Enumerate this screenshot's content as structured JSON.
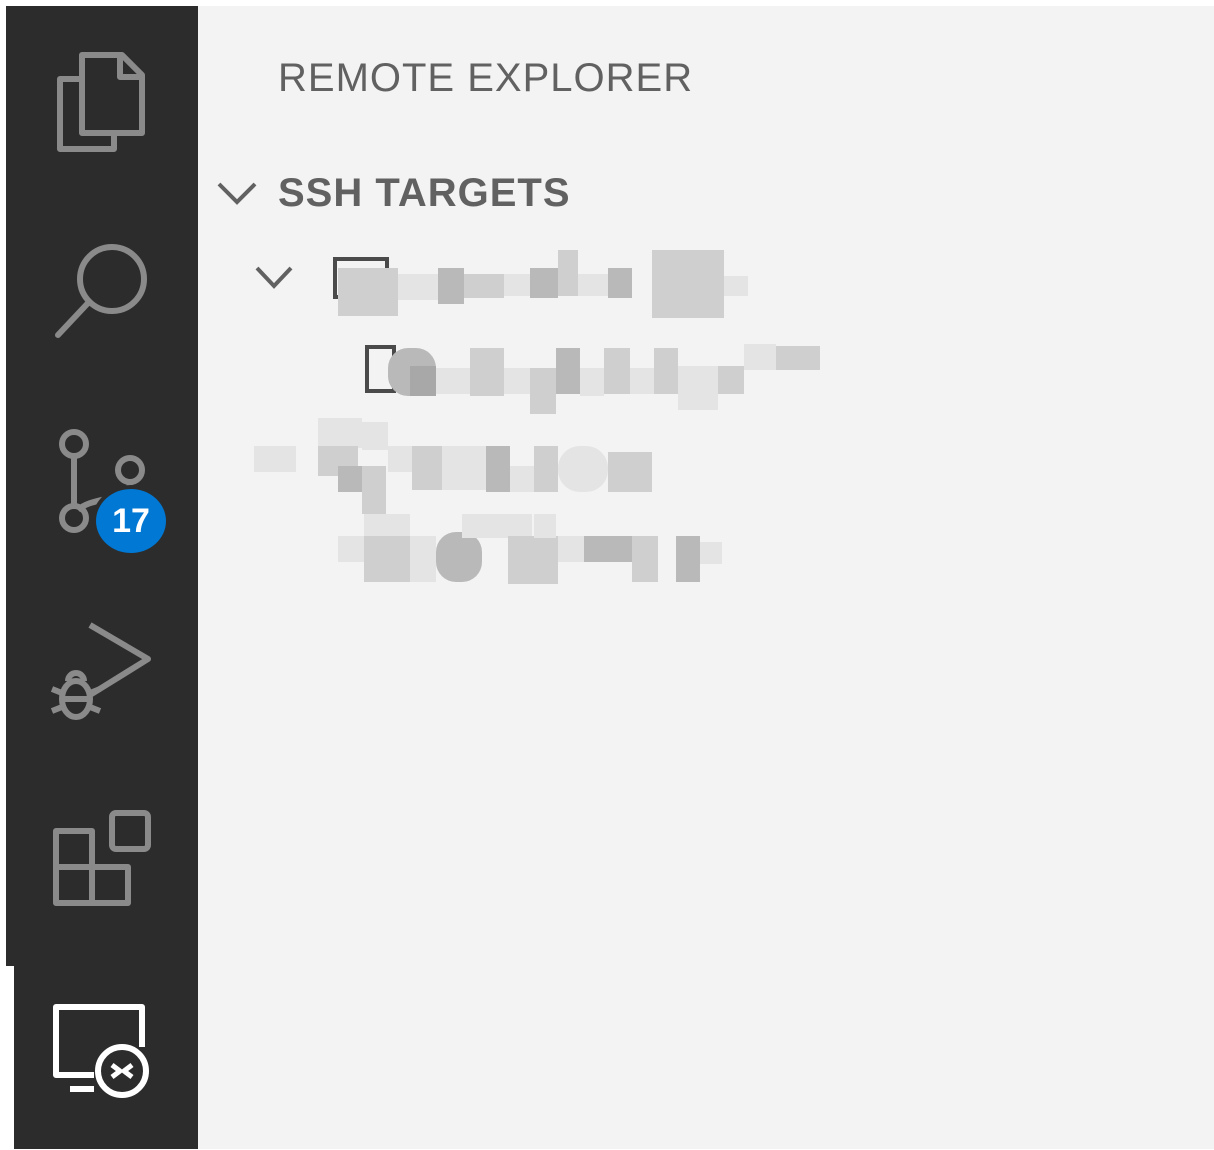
{
  "activity_bar": {
    "items": [
      {
        "name": "explorer",
        "icon": "files-icon"
      },
      {
        "name": "search",
        "icon": "search-icon"
      },
      {
        "name": "source-control",
        "icon": "source-control-icon",
        "badge": "17"
      },
      {
        "name": "run-and-debug",
        "icon": "run-debug-icon"
      },
      {
        "name": "extensions",
        "icon": "extensions-icon"
      },
      {
        "name": "remote-explorer",
        "icon": "remote-explorer-icon",
        "active": true
      }
    ]
  },
  "sidebar": {
    "title": "REMOTE EXPLORER",
    "section": {
      "title": "SSH TARGETS",
      "expanded": true
    },
    "tree": [
      {
        "kind": "host",
        "expanded": true,
        "label": ""
      },
      {
        "kind": "folder",
        "label": ""
      },
      {
        "kind": "host",
        "expanded": true,
        "label": ""
      },
      {
        "kind": "folder",
        "label": ""
      }
    ]
  },
  "colors": {
    "activity_bg": "#2c2c2c",
    "sidebar_bg": "#f3f3f3",
    "badge_bg": "#0078d4",
    "icon_stroke": "#8a8a8a",
    "text": "#616161"
  }
}
